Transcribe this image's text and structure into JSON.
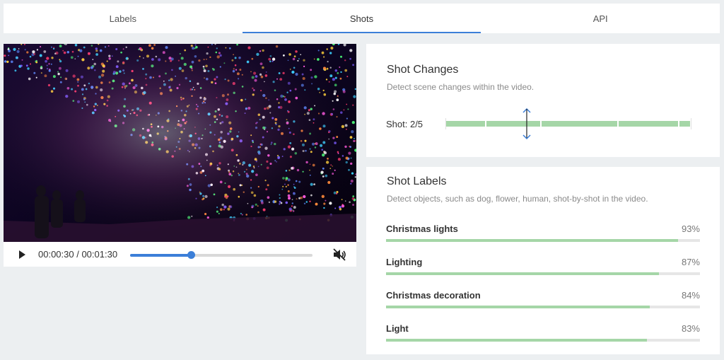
{
  "tabs": [
    {
      "label": "Labels",
      "active": false
    },
    {
      "label": "Shots",
      "active": true
    },
    {
      "label": "API",
      "active": false
    }
  ],
  "player": {
    "time_display": "00:00:30 / 00:01:30",
    "progress": 0.333,
    "muted": true,
    "play_icon": "play-icon",
    "mute_icon": "volume-off-icon",
    "accent_color": "#3c7fd8"
  },
  "shot_changes": {
    "title": "Shot Changes",
    "description": "Detect scene changes within the video.",
    "current_label": "Shot: 2/5",
    "current_shot": 2,
    "total_shots": 5,
    "segments": [
      {
        "start": 0.0,
        "end": 0.16
      },
      {
        "start": 0.167,
        "end": 0.385
      },
      {
        "start": 0.392,
        "end": 0.697
      },
      {
        "start": 0.704,
        "end": 0.945
      },
      {
        "start": 0.952,
        "end": 0.995
      }
    ],
    "marker_position": 0.33,
    "segment_color": "#a5d6a7"
  },
  "shot_labels": {
    "title": "Shot Labels",
    "description": "Detect objects, such as dog, flower, human, shot-by-shot in the video.",
    "items": [
      {
        "name": "Christmas lights",
        "percent": "93%",
        "value": 0.93
      },
      {
        "name": "Lighting",
        "percent": "87%",
        "value": 0.87
      },
      {
        "name": "Christmas decoration",
        "percent": "84%",
        "value": 0.84
      },
      {
        "name": "Light",
        "percent": "83%",
        "value": 0.83
      }
    ],
    "bar_color": "#a5d6a7"
  }
}
